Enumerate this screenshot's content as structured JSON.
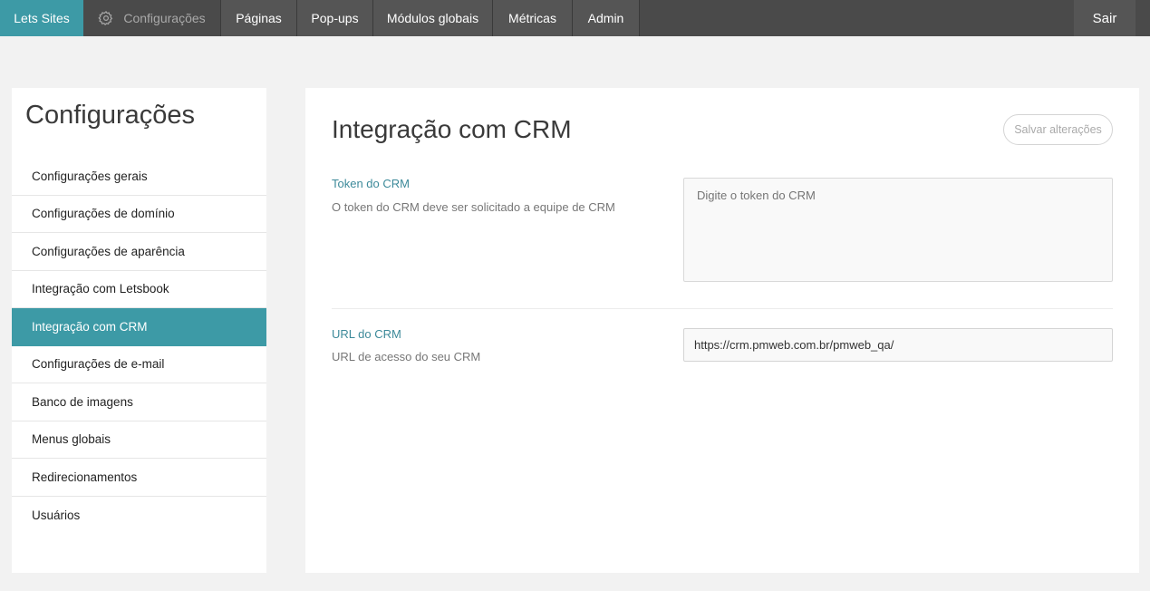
{
  "topnav": {
    "brand": "Lets Sites",
    "items": [
      {
        "label": "Configurações",
        "icon": "gear-icon",
        "active": true
      },
      {
        "label": "Páginas"
      },
      {
        "label": "Pop-ups"
      },
      {
        "label": "Módulos globais"
      },
      {
        "label": "Métricas"
      },
      {
        "label": "Admin"
      }
    ],
    "logout": "Sair"
  },
  "sidebar": {
    "title": "Configurações",
    "items": [
      {
        "label": "Configurações gerais"
      },
      {
        "label": "Configurações de domínio"
      },
      {
        "label": "Configurações de aparência"
      },
      {
        "label": "Integração com Letsbook"
      },
      {
        "label": "Integração com CRM",
        "active": true
      },
      {
        "label": "Configurações de e-mail"
      },
      {
        "label": "Banco de imagens"
      },
      {
        "label": "Menus globais"
      },
      {
        "label": "Redirecionamentos"
      },
      {
        "label": "Usuários"
      }
    ]
  },
  "main": {
    "title": "Integração com CRM",
    "save_label": "Salvar alterações",
    "token": {
      "title": "Token do CRM",
      "description": "O token do CRM deve ser solicitado a equipe de CRM",
      "placeholder": "Digite o token do CRM",
      "value": ""
    },
    "url": {
      "title": "URL do CRM",
      "description": "URL de acesso do seu CRM",
      "value": "https://crm.pmweb.com.br/pmweb_qa/"
    }
  },
  "colors": {
    "accent": "#3d9aa6",
    "nav_bg": "#4a4a4a",
    "field_title": "#3d8a9a"
  }
}
